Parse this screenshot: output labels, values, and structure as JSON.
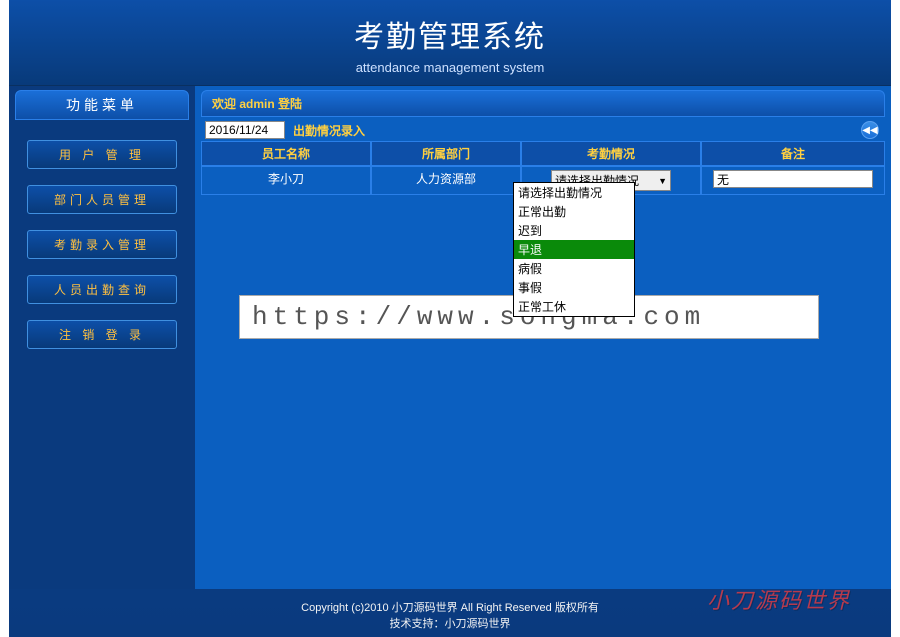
{
  "header": {
    "title": "考勤管理系统",
    "subtitle": "attendance management system"
  },
  "sidebar": {
    "heading": "功能菜单",
    "items": [
      "用 户 管 理",
      "部门人员管理",
      "考勤录入管理",
      "人员出勤查询",
      "注 销 登 录"
    ]
  },
  "welcome": {
    "prefix": "欢迎",
    "user": "admin",
    "suffix": "登陆"
  },
  "controls": {
    "date_value": "2016/11/24",
    "entry_label": "出勤情况录入",
    "nav_prev_glyph": "◀◀"
  },
  "table": {
    "headers": {
      "name": "员工名称",
      "dept": "所属部门",
      "status": "考勤情况",
      "remark": "备注"
    },
    "rows": [
      {
        "name": "李小刀",
        "dept": "人力资源部",
        "status_selected": "请选择出勤情况",
        "remark_value": "无"
      }
    ]
  },
  "dropdown": {
    "options": [
      "请选择出勤情况",
      "正常出勤",
      "迟到",
      "早退",
      "病假",
      "事假",
      "正常工休"
    ],
    "highlight_index": 3
  },
  "watermark": "https://www.songma.com",
  "footer": {
    "line1": "Copyright (c)2010   小刀源码世界   All Right Reserved   版权所有",
    "line2": "技术支持：小刀源码世界",
    "brand_mark": "小刀源码世界"
  }
}
